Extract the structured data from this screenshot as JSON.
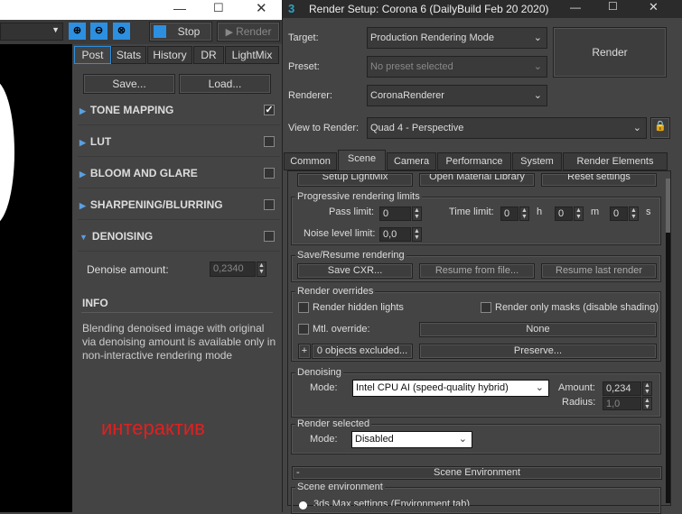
{
  "vfb": {
    "toolbar": {
      "stop": "Stop",
      "render": "Render"
    },
    "tabs": [
      "Post",
      "Stats",
      "History",
      "DR",
      "LightMix"
    ],
    "save": "Save...",
    "load": "Load...",
    "sections": [
      {
        "label": "TONE MAPPING",
        "checked": true
      },
      {
        "label": "LUT",
        "checked": false
      },
      {
        "label": "BLOOM AND GLARE",
        "checked": false
      },
      {
        "label": "SHARPENING/BLURRING",
        "checked": false
      },
      {
        "label": "DENOISING",
        "checked": false
      }
    ],
    "denoise_amount_label": "Denoise amount:",
    "denoise_amount": "0,2340",
    "info_title": "INFO",
    "info_text": "Blending denoised image with original via denoising amount is available only in non-interactive rendering mode",
    "overlay_text": "интерактив"
  },
  "rs": {
    "title": "Render Setup: Corona 6 (DailyBuild Feb 20 2020)",
    "target_label": "Target:",
    "target": "Production Rendering Mode",
    "preset_label": "Preset:",
    "preset": "No preset selected",
    "renderer_label": "Renderer:",
    "renderer": "CoronaRenderer",
    "view_label": "View to Render:",
    "view": "Quad 4 - Perspective",
    "render_btn": "Render",
    "tabs": [
      "Common",
      "Scene",
      "Camera",
      "Performance",
      "System",
      "Render Elements"
    ],
    "top_buttons": [
      "Setup LightMix",
      "Open Material Library",
      "Reset settings"
    ],
    "prog": {
      "title": "Progressive rendering limits",
      "pass_label": "Pass limit:",
      "pass": "0",
      "time_label": "Time limit:",
      "h": "0",
      "h_unit": "h",
      "m": "0",
      "m_unit": "m",
      "s": "0",
      "s_unit": "s",
      "noise_label": "Noise level limit:",
      "noise": "0,0"
    },
    "save": {
      "title": "Save/Resume rendering",
      "b1": "Save CXR...",
      "b2": "Resume from file...",
      "b3": "Resume last render"
    },
    "over": {
      "title": "Render overrides",
      "hidden": "Render hidden lights",
      "masks": "Render only masks (disable shading)",
      "mtl": "Mtl. override:",
      "none": "None",
      "plus": "+",
      "excluded": "0 objects excluded...",
      "preserve": "Preserve..."
    },
    "den": {
      "title": "Denoising",
      "mode_label": "Mode:",
      "mode": "Intel CPU AI (speed-quality hybrid)",
      "amount_label": "Amount:",
      "amount": "0,234",
      "radius_label": "Radius:",
      "radius": "1,0"
    },
    "rsel": {
      "title": "Render selected",
      "mode_label": "Mode:",
      "mode": "Disabled"
    },
    "env": {
      "rollout": "Scene Environment",
      "minus": "-",
      "title": "Scene environment",
      "opt": "3ds Max settings (Environment tab)"
    }
  }
}
